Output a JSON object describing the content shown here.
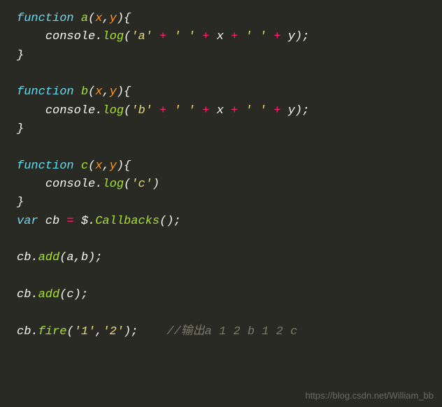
{
  "code": {
    "fnA": {
      "kw": "function",
      "name": "a",
      "lp": "(",
      "p1": "x",
      "comma": ",",
      "p2": "y",
      "rp": ")",
      "lb": "{",
      "body": {
        "obj": "console",
        "dot": ".",
        "method": "log",
        "lp": "(",
        "s1": "'a'",
        "plus1": " + ",
        "s2": "' '",
        "plus2": " + ",
        "v1": "x",
        "plus3": " + ",
        "s3": "' '",
        "plus4": " + ",
        "v2": "y",
        "rp": ")",
        "semi": ";"
      },
      "rb": "}"
    },
    "fnB": {
      "kw": "function",
      "name": "b",
      "lp": "(",
      "p1": "x",
      "comma": ",",
      "p2": "y",
      "rp": ")",
      "lb": "{",
      "body": {
        "obj": "console",
        "dot": ".",
        "method": "log",
        "lp": "(",
        "s1": "'b'",
        "plus1": " + ",
        "s2": "' '",
        "plus2": " + ",
        "v1": "x",
        "plus3": " + ",
        "s3": "' '",
        "plus4": " + ",
        "v2": "y",
        "rp": ")",
        "semi": ";"
      },
      "rb": "}"
    },
    "fnC": {
      "kw": "function",
      "name": "c",
      "lp": "(",
      "p1": "x",
      "comma": ",",
      "p2": "y",
      "rp": ")",
      "lb": "{",
      "body": {
        "obj": "console",
        "dot": ".",
        "method": "log",
        "lp": "(",
        "s1": "'c'",
        "rp": ")"
      },
      "rb": "}"
    },
    "varDecl": {
      "kw": "var",
      "name": " cb ",
      "eq": "=",
      "sp": " ",
      "jq": "$",
      "dot": ".",
      "call": "Callbacks",
      "parens": "()",
      "semi": ";"
    },
    "add1": {
      "obj": "cb",
      "dot": ".",
      "method": "add",
      "lp": "(",
      "a1": "a",
      "comma": ",",
      "a2": "b",
      "rp": ")",
      "semi": ";"
    },
    "add2": {
      "obj": "cb",
      "dot": ".",
      "method": "add",
      "lp": "(",
      "a1": "c",
      "rp": ")",
      "semi": ";"
    },
    "fire": {
      "obj": "cb",
      "dot": ".",
      "method": "fire",
      "lp": "(",
      "s1": "'1'",
      "comma": ",",
      "s2": "'2'",
      "rp": ")",
      "semi": ";",
      "gap": "    ",
      "comment": "//输出a 1 2 b 1 2 c"
    }
  },
  "watermark": "https://blog.csdn.net/William_bb"
}
